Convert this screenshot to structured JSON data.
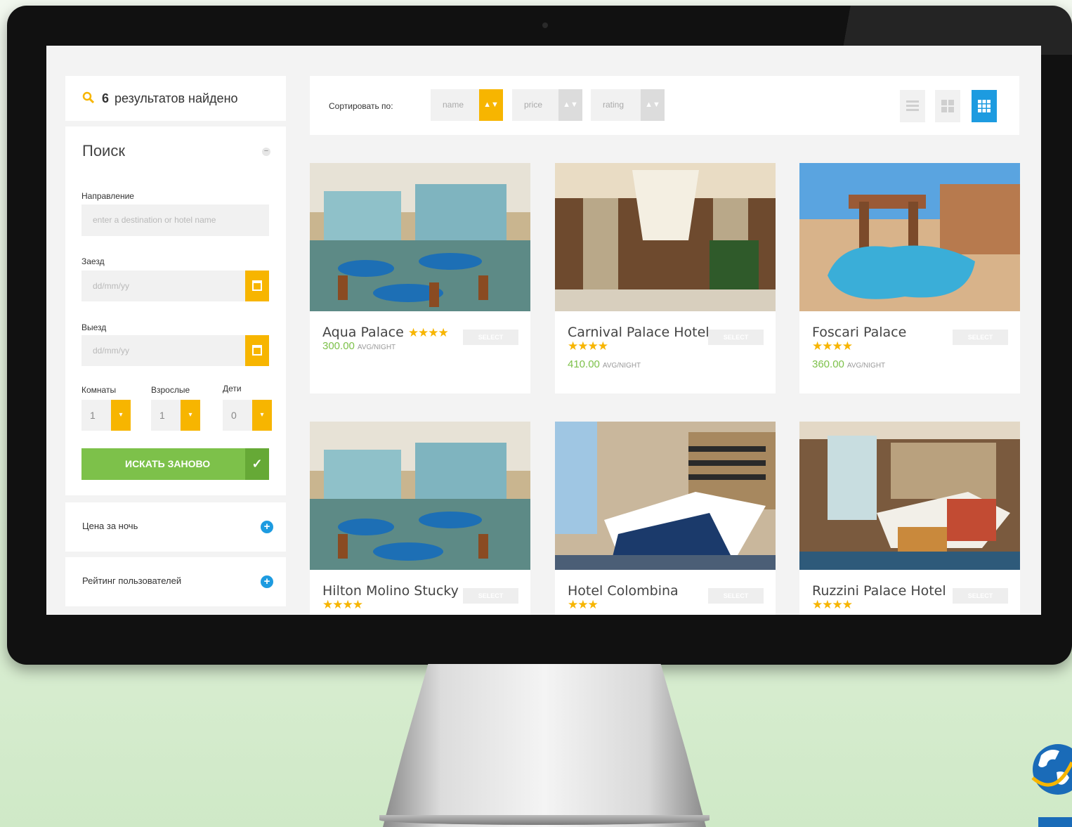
{
  "results": {
    "count": "6",
    "label": "результатов найдено"
  },
  "search": {
    "title": "Поиск",
    "collapse_icon": "−",
    "destination_label": "Направление",
    "destination_placeholder": "enter a destination or hotel name",
    "checkin_label": "Заезд",
    "checkin_placeholder": "dd/mm/yy",
    "checkout_label": "Выезд",
    "checkout_placeholder": "dd/mm/yy",
    "rooms_label": "Комнаты",
    "rooms_value": "1",
    "adults_label": "Взрослые",
    "adults_value": "1",
    "children_label": "Дети",
    "children_value": "0",
    "spin_arrow": "▾",
    "search_button": "ИСКАТЬ ЗАНОВО",
    "check_icon": "✓"
  },
  "filters": [
    {
      "label": "Цена за ночь",
      "icon": "+"
    },
    {
      "label": "Рейтинг пользователей",
      "icon": "+"
    }
  ],
  "sort": {
    "label": "Сортировать по:",
    "options": [
      "name",
      "price",
      "rating"
    ],
    "arrow": "▲▼",
    "active": "name"
  },
  "views": [
    "list-view-icon",
    "grid-view-icon",
    "block-view-icon"
  ],
  "hotels": [
    {
      "name": "Aqua Palace",
      "stars": "★★★★",
      "price": "300.00",
      "unit": "AVG/NIGHT",
      "select": "SELECT"
    },
    {
      "name": "Carnival Palace Hotel",
      "stars": "★★★★",
      "price": "410.00",
      "unit": "AVG/NIGHT",
      "select": "SELECT"
    },
    {
      "name": "Foscari Palace",
      "stars": "★★★★",
      "price": "360.00",
      "unit": "AVG/NIGHT",
      "select": "SELECT"
    },
    {
      "name": "Hilton Molino Stucky",
      "stars": "★★★★",
      "select": "SELECT"
    },
    {
      "name": "Hotel Colombina",
      "stars": "★★★",
      "select": "SELECT"
    },
    {
      "name": "Ruzzini Palace Hotel",
      "stars": "★★★★",
      "select": "SELECT"
    }
  ],
  "colors": {
    "accent_yellow": "#f7b500",
    "accent_green": "#7dc14a",
    "accent_blue": "#1d9be0"
  }
}
